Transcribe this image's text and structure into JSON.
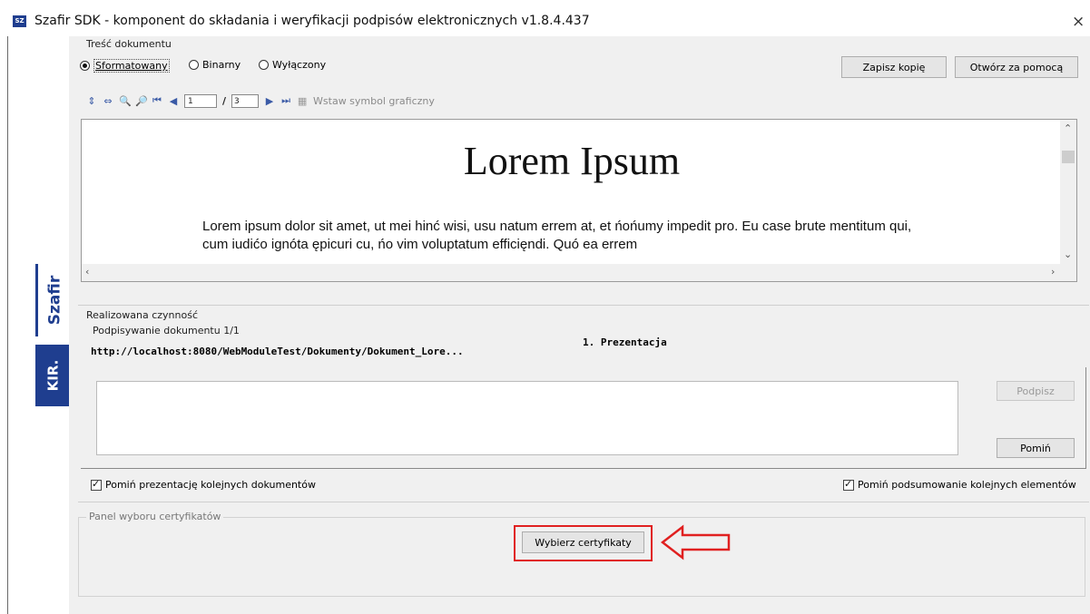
{
  "window": {
    "title": "Szafir SDK - komponent do składania i weryfikacji podpisów elektronicznych v1.8.4.437",
    "icon_label": "SZ",
    "close_glyph": "×"
  },
  "branding": {
    "product": "Szafir",
    "company": "KIR."
  },
  "document_content": {
    "group_label": "Treść dokumentu",
    "modes": [
      {
        "label": "Sformatowany",
        "selected": true
      },
      {
        "label": "Binarny",
        "selected": false
      },
      {
        "label": "Wyłączony",
        "selected": false
      }
    ],
    "save_copy_label": "Zapisz kopię",
    "open_with_label": "Otwórz za pomocą",
    "toolbar": {
      "current_page": "1",
      "page_separator": "/",
      "total_pages": "3",
      "insert_symbol_label": "Wstaw symbol graficzny"
    },
    "preview": {
      "title": "Lorem Ipsum",
      "body": "Lorem ipsum dolor sit amet, ut mei hinć wisi, usu natum errem at, et ńońumy impedit pro. Eu case brute mentitum qui, cum iudićo ignóta ępicuri cu, ńo vim voluptatum efficięndi. Quó ea errem"
    }
  },
  "current_action": {
    "group_label": "Realizowana czynność",
    "signing_status": "Podpisywanie dokumentu 1/1",
    "document_url": "http://localhost:8080/WebModuleTest/Dokumenty/Dokument_Lore...",
    "step_label": "1. Prezentacja",
    "sign_button": "Podpisz",
    "skip_button": "Pomiń"
  },
  "options": {
    "skip_presentation": {
      "label": "Pomiń prezentację kolejnych dokumentów",
      "checked": true
    },
    "skip_summary": {
      "label": "Pomiń podsumowanie kolejnych elementów",
      "checked": true
    }
  },
  "certificate_panel": {
    "group_label": "Panel wyboru certyfikatów",
    "select_button": "Wybierz certyfikaty"
  },
  "annotation": {
    "highlight_color": "#e02020"
  },
  "colors": {
    "brand": "#1f3e8f",
    "background": "#f0f0f0"
  }
}
